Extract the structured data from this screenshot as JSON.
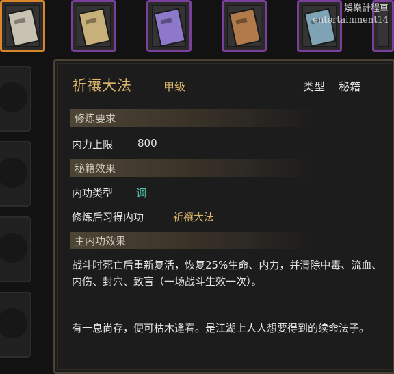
{
  "watermark": {
    "line1": "娛樂計程車",
    "line2": "entertainment14"
  },
  "inventory": {
    "slots": [
      {
        "name": "slot-1",
        "color": "#c9c2b2",
        "selected": true
      },
      {
        "name": "slot-2",
        "color": "#c8b07a"
      },
      {
        "name": "slot-3",
        "color": "#8d78c9"
      },
      {
        "name": "slot-4",
        "color": "#b07a4a"
      },
      {
        "name": "slot-5",
        "color": "#7ea3b5"
      },
      {
        "name": "slot-6",
        "color": "#8fb3c2"
      }
    ]
  },
  "tooltip": {
    "title": "祈禳大法",
    "grade": "甲级",
    "type_label": "类型",
    "type_value": "秘籍",
    "requirements_header": "修炼要求",
    "req_stat_label": "内力上限",
    "req_stat_value": "800",
    "effects_header": "秘籍效果",
    "internal_type_label": "内功类型",
    "internal_type_value": "调",
    "learn_label": "修炼后习得内功",
    "learn_value": "祈禳大法",
    "main_effect_header": "主内功效果",
    "main_effect_text": "战斗时死亡后重新复活，恢复25%生命、内力，并清除中毒、流血、内伤、封穴、致盲（一场战斗生效一次）。",
    "flavor_text": "有一息尚存，便可枯木逢春。是江湖上人人想要得到的续命法子。"
  },
  "colors": {
    "title": "#d9b46a",
    "accent_teal": "#4fc7b0",
    "panel_bg": "#1c1c1c",
    "border": "#4a4034",
    "selected_slot": "#d8852c",
    "slot_border": "#7a3f9a"
  }
}
